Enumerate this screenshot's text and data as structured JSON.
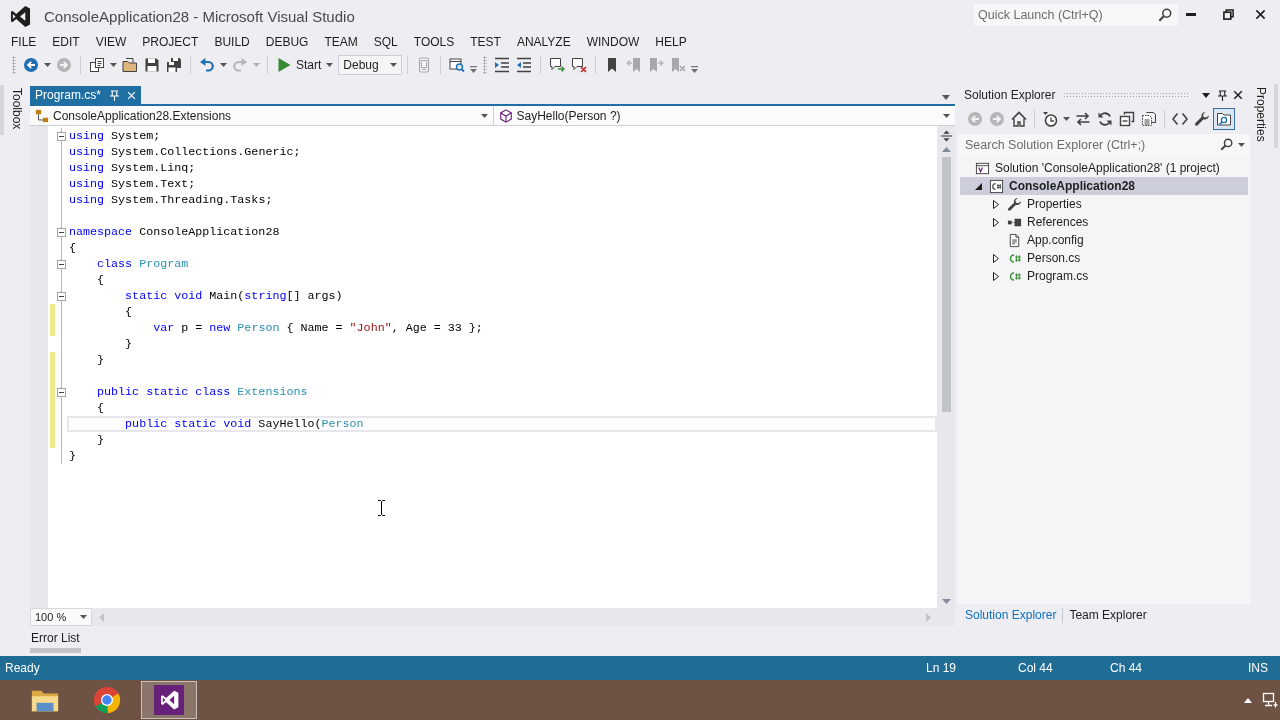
{
  "window": {
    "title": "ConsoleApplication28 - Microsoft Visual Studio"
  },
  "quick_launch": {
    "placeholder": "Quick Launch (Ctrl+Q)"
  },
  "menu": [
    "FILE",
    "EDIT",
    "VIEW",
    "PROJECT",
    "BUILD",
    "DEBUG",
    "TEAM",
    "SQL",
    "TOOLS",
    "TEST",
    "ANALYZE",
    "WINDOW",
    "HELP"
  ],
  "toolbar": [
    {
      "kind": "grip"
    },
    {
      "kind": "button",
      "disabled": false,
      "dropdown": true
    },
    {
      "kind": "button",
      "disabled": true,
      "dropdown": false
    },
    {
      "kind": "separator"
    },
    {
      "kind": "button",
      "disabled": false,
      "dropdown": true
    },
    {
      "kind": "button",
      "disabled": false,
      "dropdown": false
    },
    {
      "kind": "button",
      "disabled": false,
      "dropdown": false
    },
    {
      "kind": "button",
      "disabled": false,
      "dropdown": false
    },
    {
      "kind": "separator"
    },
    {
      "kind": "button",
      "disabled": false,
      "dropdown": true
    },
    {
      "kind": "button",
      "disabled": true,
      "dropdown": true
    },
    {
      "kind": "separator"
    },
    {
      "kind": "run",
      "label": "Start",
      "disabled": false,
      "dropdown": true
    },
    {
      "kind": "combo",
      "value": "Debug"
    },
    {
      "kind": "separator"
    },
    {
      "kind": "button",
      "disabled": true,
      "dropdown": false
    },
    {
      "kind": "separator"
    },
    {
      "kind": "button",
      "disabled": false,
      "dropdown": false
    },
    {
      "kind": "overflow"
    },
    {
      "kind": "grip"
    },
    {
      "kind": "button",
      "disabled": false,
      "dropdown": false
    },
    {
      "kind": "button",
      "disabled": false,
      "dropdown": false
    },
    {
      "kind": "separator"
    },
    {
      "kind": "button",
      "disabled": false,
      "dropdown": false
    },
    {
      "kind": "button",
      "disabled": false,
      "dropdown": false
    },
    {
      "kind": "separator"
    },
    {
      "kind": "button",
      "disabled": false,
      "dropdown": false
    },
    {
      "kind": "button",
      "disabled": true,
      "dropdown": false
    },
    {
      "kind": "button",
      "disabled": true,
      "dropdown": false
    },
    {
      "kind": "button",
      "disabled": true,
      "dropdown": false
    },
    {
      "kind": "overflow"
    }
  ],
  "toolbox_tab": {
    "label": "Toolbox"
  },
  "editor": {
    "tabs": [
      {
        "label": "Program.cs*",
        "selected": true
      }
    ],
    "navigation": {
      "type": "ConsoleApplication28.Extensions",
      "member": "SayHello(Person ?)"
    },
    "lines": [
      {
        "tokens": [
          {
            "kind": "keyword",
            "text": "using"
          },
          {
            "kind": "plain",
            "text": " System;"
          }
        ],
        "expanded": true,
        "changed": false,
        "current": false
      },
      {
        "tokens": [
          {
            "kind": "keyword",
            "text": "using"
          },
          {
            "kind": "plain",
            "text": " System.Collections.Generic;"
          }
        ],
        "changed": false,
        "current": false
      },
      {
        "tokens": [
          {
            "kind": "keyword",
            "text": "using"
          },
          {
            "kind": "plain",
            "text": " System.Linq;"
          }
        ],
        "changed": false,
        "current": false
      },
      {
        "tokens": [
          {
            "kind": "keyword",
            "text": "using"
          },
          {
            "kind": "plain",
            "text": " System.Text;"
          }
        ],
        "changed": false,
        "current": false
      },
      {
        "tokens": [
          {
            "kind": "keyword",
            "text": "using"
          },
          {
            "kind": "plain",
            "text": " System.Threading.Tasks;"
          }
        ],
        "changed": false,
        "current": false
      },
      {
        "changed": false,
        "current": false
      },
      {
        "tokens": [
          {
            "kind": "keyword",
            "text": "namespace"
          },
          {
            "kind": "plain",
            "text": " ConsoleApplication28"
          }
        ],
        "expanded": true,
        "changed": false,
        "current": false
      },
      {
        "tokens": [
          {
            "kind": "plain",
            "text": "{"
          }
        ],
        "changed": false,
        "current": false
      },
      {
        "tokens": [
          {
            "kind": "keyword",
            "text": "    class "
          },
          {
            "kind": "type",
            "text": "Program"
          }
        ],
        "expanded": true,
        "changed": false,
        "current": false
      },
      {
        "tokens": [
          {
            "kind": "plain",
            "text": "    {"
          }
        ],
        "changed": false,
        "current": false
      },
      {
        "tokens": [
          {
            "kind": "keyword",
            "text": "        static void"
          },
          {
            "kind": "plain",
            "text": " Main("
          },
          {
            "kind": "keyword",
            "text": "string"
          },
          {
            "kind": "plain",
            "text": "[] args)"
          }
        ],
        "expanded": true,
        "changed": false,
        "current": false
      },
      {
        "tokens": [
          {
            "kind": "plain",
            "text": "        {"
          }
        ],
        "changed": true,
        "current": false
      },
      {
        "tokens": [
          {
            "kind": "keyword",
            "text": "            var"
          },
          {
            "kind": "plain",
            "text": " p = "
          },
          {
            "kind": "keyword",
            "text": "new "
          },
          {
            "kind": "type",
            "text": "Person"
          },
          {
            "kind": "plain",
            "text": " { Name = "
          },
          {
            "kind": "string",
            "text": "\"John\""
          },
          {
            "kind": "plain",
            "text": ", Age = 33 };"
          }
        ],
        "changed": true,
        "current": false
      },
      {
        "tokens": [
          {
            "kind": "plain",
            "text": "        }"
          }
        ],
        "changed": false,
        "current": false
      },
      {
        "tokens": [
          {
            "kind": "plain",
            "text": "    }"
          }
        ],
        "changed": true,
        "current": false
      },
      {
        "changed": true,
        "current": false
      },
      {
        "tokens": [
          {
            "kind": "keyword",
            "text": "    public static class "
          },
          {
            "kind": "type",
            "text": "Extensions"
          }
        ],
        "expanded": true,
        "changed": true,
        "current": false
      },
      {
        "tokens": [
          {
            "kind": "plain",
            "text": "    {"
          }
        ],
        "changed": true,
        "current": false
      },
      {
        "tokens": [
          {
            "kind": "keyword",
            "text": "        public static void"
          },
          {
            "kind": "plain",
            "text": " SayHello("
          },
          {
            "kind": "type",
            "text": "Person"
          }
        ],
        "changed": true,
        "current": true
      },
      {
        "tokens": [
          {
            "kind": "plain",
            "text": "    }"
          }
        ],
        "changed": true,
        "current": false
      },
      {
        "tokens": [
          {
            "kind": "plain",
            "text": "}"
          }
        ],
        "changed": false,
        "current": false
      }
    ],
    "zoom": "100 %"
  },
  "bottom_tabs": [
    {
      "label": "Error List"
    }
  ],
  "solution_explorer": {
    "title": "Solution Explorer",
    "toolbar": [
      {
        "kind": "button",
        "disabled": true,
        "on": false,
        "dropdown": false
      },
      {
        "kind": "button",
        "disabled": true,
        "on": false,
        "dropdown": false
      },
      {
        "kind": "button",
        "disabled": false,
        "on": false,
        "dropdown": false
      },
      {
        "kind": "separator"
      },
      {
        "kind": "button",
        "disabled": false,
        "on": false,
        "dropdown": true
      },
      {
        "kind": "button",
        "disabled": false,
        "on": false,
        "dropdown": false
      },
      {
        "kind": "button",
        "disabled": false,
        "on": false,
        "dropdown": false
      },
      {
        "kind": "button",
        "disabled": false,
        "on": false,
        "dropdown": false
      },
      {
        "kind": "button",
        "disabled": false,
        "on": false,
        "dropdown": false
      },
      {
        "kind": "separator"
      },
      {
        "kind": "button",
        "disabled": false,
        "on": false,
        "dropdown": false
      },
      {
        "kind": "button",
        "disabled": false,
        "on": false,
        "dropdown": false
      },
      {
        "kind": "button",
        "disabled": false,
        "on": true,
        "dropdown": false
      }
    ],
    "search": {
      "placeholder": "Search Solution Explorer (Ctrl+;)"
    },
    "tree": [
      {
        "kind": "solution",
        "label": "Solution 'ConsoleApplication28' (1 project)",
        "selected": false,
        "children": [
          {
            "kind": "project",
            "label": "ConsoleApplication28",
            "selected": true,
            "expanded": true,
            "startup": true,
            "children": [
              {
                "kind": "folder",
                "label": "Properties",
                "selected": false,
                "expanded": false
              },
              {
                "kind": "references",
                "label": "References",
                "selected": false,
                "expanded": false
              },
              {
                "kind": "config",
                "label": "App.config",
                "selected": false
              },
              {
                "kind": "code",
                "label": "Person.cs",
                "selected": false,
                "expanded": false
              },
              {
                "kind": "code",
                "label": "Program.cs",
                "selected": false,
                "expanded": false
              }
            ]
          }
        ]
      }
    ],
    "tabs": [
      {
        "label": "Solution Explorer",
        "selected": true
      },
      {
        "label": "Team Explorer",
        "selected": false
      }
    ]
  },
  "properties_tab": {
    "label": "Properties"
  },
  "status_bar": [
    "Ready",
    "Ln 19",
    "Col 44",
    "Ch 44",
    "INS"
  ],
  "taskbar": {
    "apps": [
      {
        "selected": false
      },
      {
        "selected": false
      },
      {
        "selected": true
      }
    ]
  }
}
